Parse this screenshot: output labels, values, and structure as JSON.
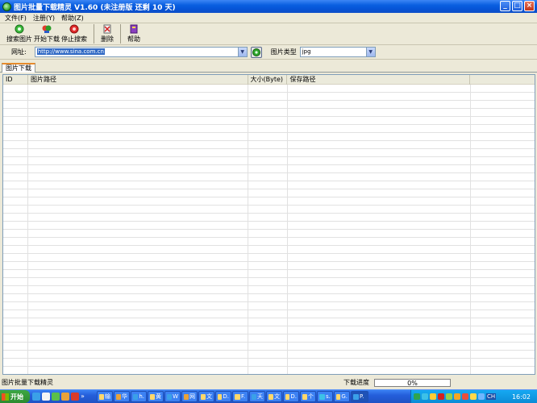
{
  "window": {
    "title": "图片批量下载精灵 V1.60 (未注册版 还剩 10 天)",
    "controls": {
      "minimize": "_",
      "maximize": "□",
      "close": "×"
    }
  },
  "menu": [
    "文件(F)",
    "注册(Y)",
    "帮助(Z)"
  ],
  "toolbar": {
    "search": "搜索图片",
    "start_download": "开始下载",
    "stop_search": "停止搜索",
    "delete": "删除",
    "help": "帮助"
  },
  "address": {
    "label": "网址:",
    "url": "http://www.sina.com.cn",
    "type_label": "图片类型",
    "type_value": "jpg"
  },
  "tabs": [
    "图片下载"
  ],
  "list": {
    "columns": [
      "ID",
      "图片路径",
      "大小(Byte)",
      "保存路径"
    ]
  },
  "status": {
    "left_text": "图片批量下载精灵",
    "progress_label": "下载进度",
    "progress_text": "0%",
    "progress_value": 0
  },
  "taskbar": {
    "start_label": "开始",
    "chevron": "»",
    "tasks": [
      "输",
      "华",
      "h.",
      "黄",
      "W",
      "网",
      "文",
      "D.",
      "F.",
      "天",
      "文",
      "D.",
      "个",
      "s.",
      "G.",
      "P."
    ],
    "active_task_index": 15,
    "lang": "CH",
    "clock": "16:02"
  },
  "colors": {
    "titlebar": "#0a5fe0",
    "selection": "#316ac5",
    "window_bg": "#ece9d8",
    "taskbar": "#245edb",
    "start": "#2c8a2f"
  }
}
